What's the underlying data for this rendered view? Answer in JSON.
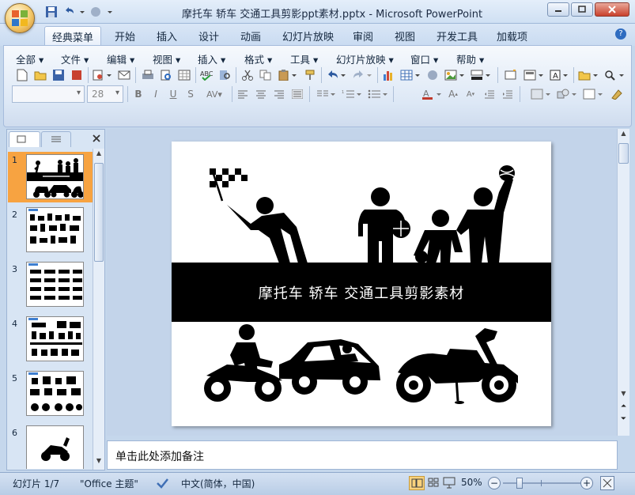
{
  "title": "摩托车 轿车 交通工具剪影ppt素材.pptx - Microsoft PowerPoint",
  "tabs": [
    "经典菜单",
    "开始",
    "插入",
    "设计",
    "动画",
    "幻灯片放映",
    "审阅",
    "视图",
    "开发工具",
    "加载项"
  ],
  "menus": [
    "全部",
    "文件",
    "编辑",
    "视图",
    "插入",
    "格式",
    "工具",
    "幻灯片放映",
    "窗口",
    "帮助"
  ],
  "font_size": "28",
  "slide_nums": [
    "1",
    "2",
    "3",
    "4",
    "5",
    "6"
  ],
  "slide_title": "摩托车 轿车 交通工具剪影素材",
  "notes_placeholder": "单击此处添加备注",
  "status": {
    "slide": "幻灯片 1/7",
    "theme": "\"Office 主题\"",
    "lang": "中文(简体，中国)",
    "zoom": "50%"
  },
  "zoom_level": 0.5,
  "colors": {
    "accent": "#f7a341",
    "ribbon": "#dde8f6"
  }
}
